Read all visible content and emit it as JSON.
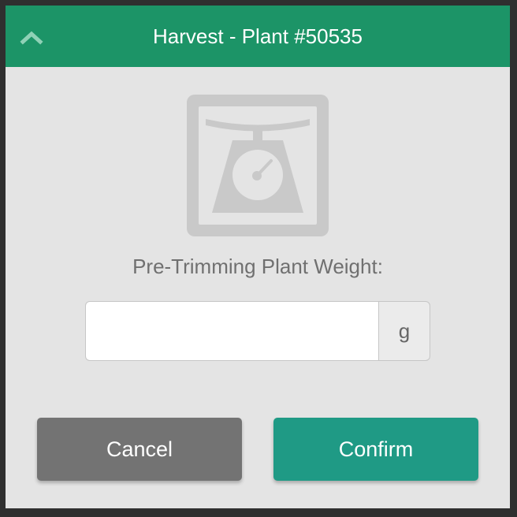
{
  "header": {
    "title": "Harvest - Plant #50535",
    "background": "#1c9467",
    "collapse_icon": "chevron-up-icon"
  },
  "main": {
    "illustration_icon": "scale-icon",
    "weight_label": "Pre-Trimming Plant Weight:",
    "weight_input": {
      "value": "",
      "placeholder": ""
    },
    "unit": "g"
  },
  "actions": {
    "cancel_label": "Cancel",
    "confirm_label": "Confirm",
    "cancel_color": "#737373",
    "confirm_color": "#1f9a85"
  }
}
